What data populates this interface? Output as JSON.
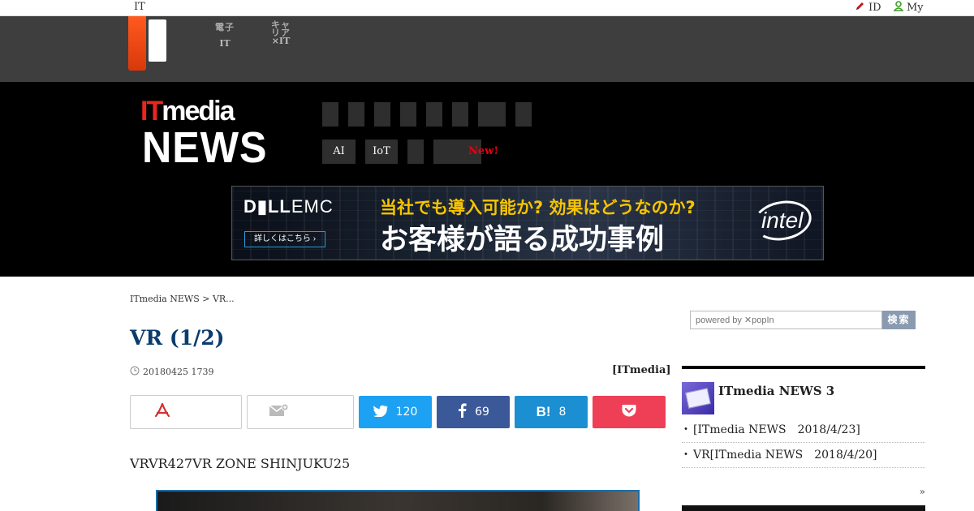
{
  "topbar": {
    "it_label": "IT",
    "id_label": "ID",
    "my_label": "My"
  },
  "graynav": {
    "item1_ja": "電子",
    "item1_label": "IT",
    "item2_ja": "キャリア",
    "item2_label": "×IT"
  },
  "brand": {
    "top_prefix": "IT",
    "top_suffix": "media",
    "bottom": "NEWS"
  },
  "categories": {
    "row2": {
      "ai": "AI",
      "iot": "IoT",
      "new_badge": "New!"
    }
  },
  "ad": {
    "brand_bold": "D▮LL",
    "brand_rest": "EMC",
    "more_label": "詳しくはこちら ›",
    "line1": "当社でも導入可能か? 効果はどうなのか?",
    "line2": "お客様が語る成功事例",
    "partner": "intel"
  },
  "article": {
    "breadcrumb": "ITmedia NEWS > VR...",
    "title": "VR (1/2)",
    "date": "20180425 1739",
    "source": "[ITmedia]",
    "lead": "VRVR427VR ZONE SHINJUKU25"
  },
  "share": {
    "twitter_count": "120",
    "facebook_count": "69",
    "hatena_label": "B!",
    "hatena_count": "8"
  },
  "sidebar": {
    "search_placeholder": "powered by ✕popIn",
    "search_button": "検索",
    "panel_title": "ITmedia NEWS 3",
    "items": [
      "[ITmedia NEWS　2018/4/23]",
      "VR[ITmedia NEWS　2018/4/20]"
    ],
    "more": "»"
  },
  "colors": {
    "brand_orange": "#ff5a1f",
    "title_blue": "#0b3c6e",
    "twitter": "#1da1f2",
    "facebook": "#3b5998",
    "hatena": "#1b8fd2",
    "pocket": "#ef3f56",
    "new_badge": "#e60012"
  },
  "icons": {
    "id": "pencil-icon",
    "my": "user-icon",
    "date": "clock-icon",
    "pdf": "pdf-icon",
    "mail": "mail-add-icon",
    "twitter": "twitter-icon",
    "facebook": "facebook-icon",
    "pocket": "pocket-icon"
  }
}
